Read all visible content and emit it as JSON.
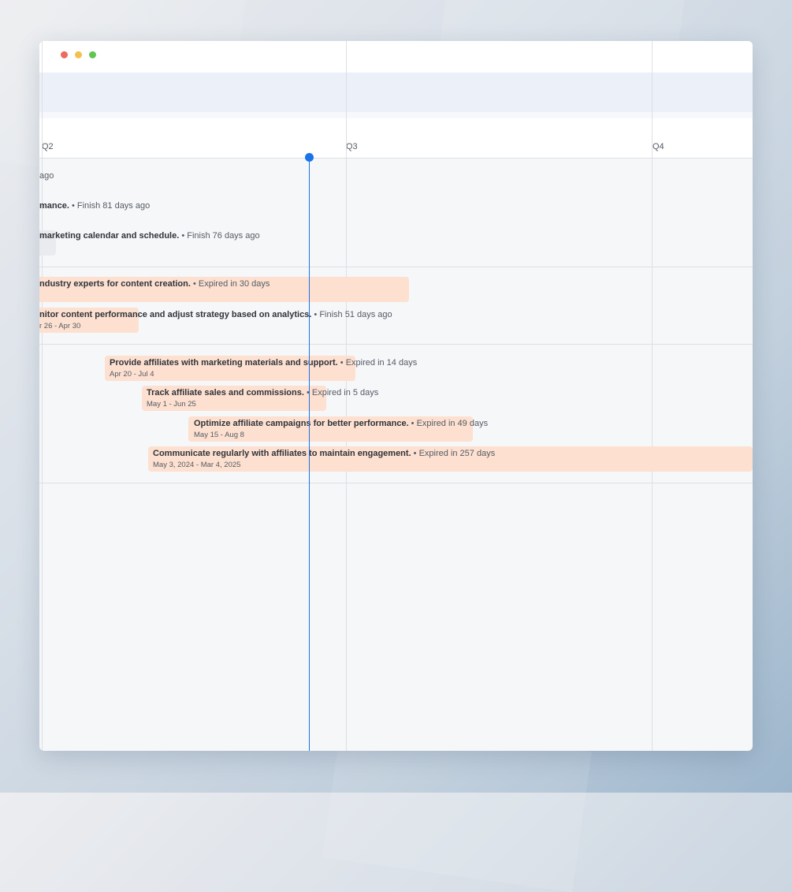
{
  "window": {
    "controls": [
      "close",
      "minimize",
      "maximize"
    ]
  },
  "colors": {
    "close": "#ed6a5e",
    "minimize": "#f4bf4f",
    "maximize": "#61c554",
    "today_marker": "#1a73e8",
    "task_bar": "#fde0d0",
    "task_bar_done": "#e9ebee"
  },
  "timeline": {
    "quarters": [
      {
        "label": "Q2"
      },
      {
        "label": "Q3"
      },
      {
        "label": "Q4"
      }
    ]
  },
  "tasks": [
    {
      "title": "",
      "status": "ago"
    },
    {
      "title": "mance.",
      "status": " • Finish 81 days ago"
    },
    {
      "title": "marketing calendar and schedule.",
      "status": " • Finish 76 days ago"
    },
    {
      "title": "ndustry experts for content creation.",
      "status": " • Expired in 30 days"
    },
    {
      "title": "nitor content performance and adjust strategy based on analytics.",
      "status": " • Finish 51 days ago",
      "dates": "r 26 - Apr 30"
    },
    {
      "title": "Provide affiliates with marketing materials and support.",
      "status": " • Expired in 14 days",
      "dates": "Apr 20 - Jul 4"
    },
    {
      "title": "Track affiliate sales and commissions.",
      "status": " • Expired in 5 days",
      "dates": "May 1 - Jun 25"
    },
    {
      "title": "Optimize affiliate campaigns for better performance.",
      "status": " • Expired in 49 days",
      "dates": "May 15 - Aug 8"
    },
    {
      "title": "Communicate regularly with affiliates to maintain engagement.",
      "status": " • Expired in 257 days",
      "dates": "May 3, 2024 - Mar 4, 2025"
    }
  ]
}
